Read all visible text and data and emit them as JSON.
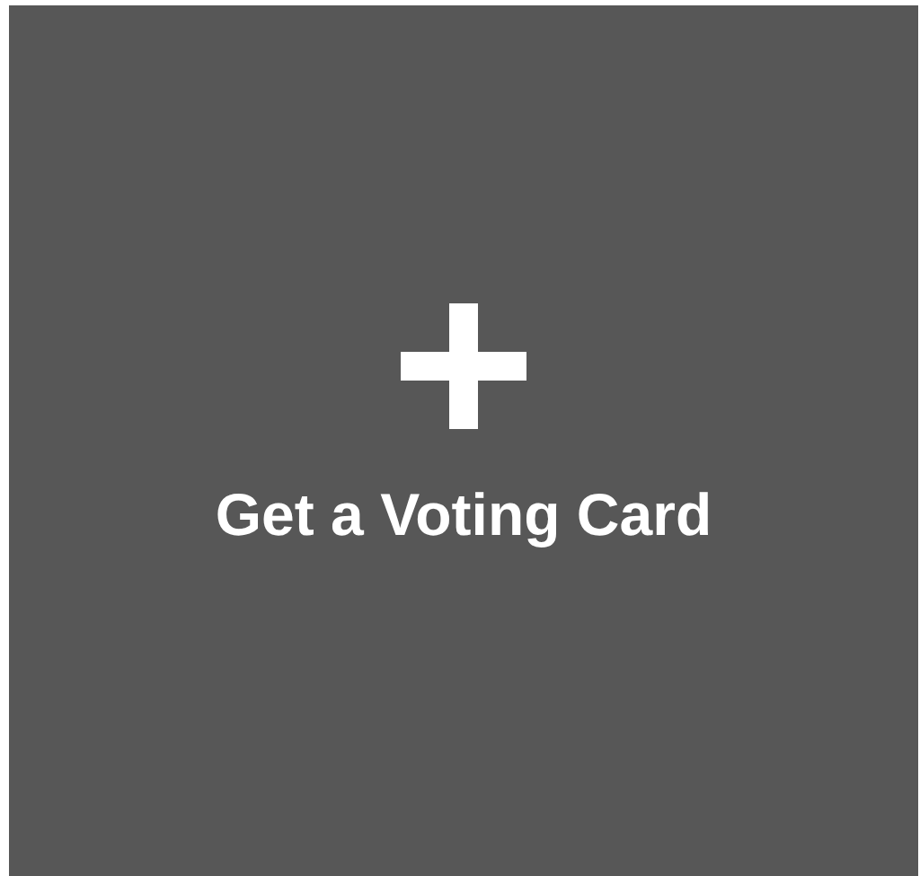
{
  "card": {
    "label": "Get a Voting Card"
  }
}
